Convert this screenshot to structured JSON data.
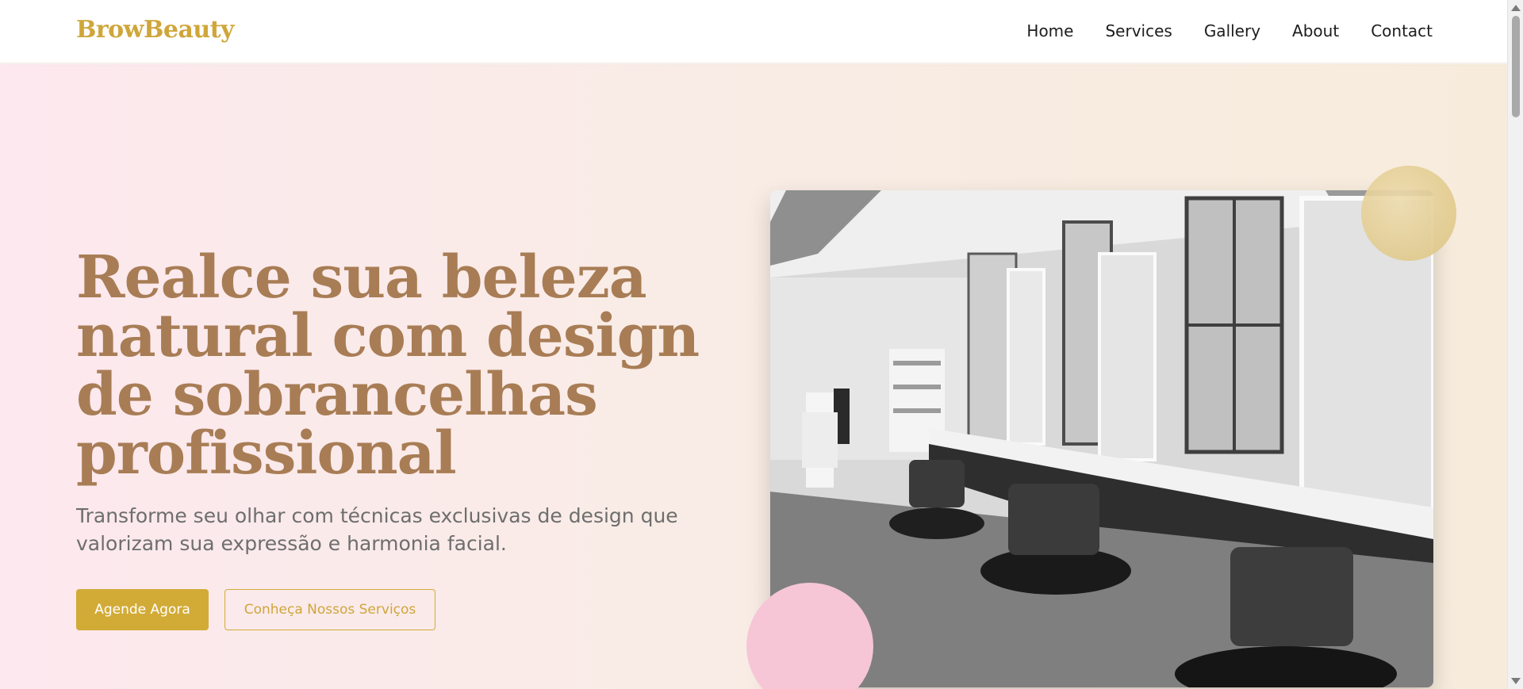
{
  "header": {
    "logo": "BrowBeauty",
    "nav": [
      "Home",
      "Services",
      "Gallery",
      "About",
      "Contact"
    ]
  },
  "hero": {
    "headline": "Realce sua beleza natural com design de sobrancelhas profissional",
    "subtitle": "Transforme seu olhar com técnicas exclusivas de design que valorizam sua expressão e harmonia facial.",
    "primary_button": "Agende Agora",
    "secondary_button": "Conheça Nossos Serviços"
  },
  "colors": {
    "brand_gold": "#d2ab37",
    "headline_brown": "#a87d55",
    "accent_pink": "#f6c6d6"
  }
}
